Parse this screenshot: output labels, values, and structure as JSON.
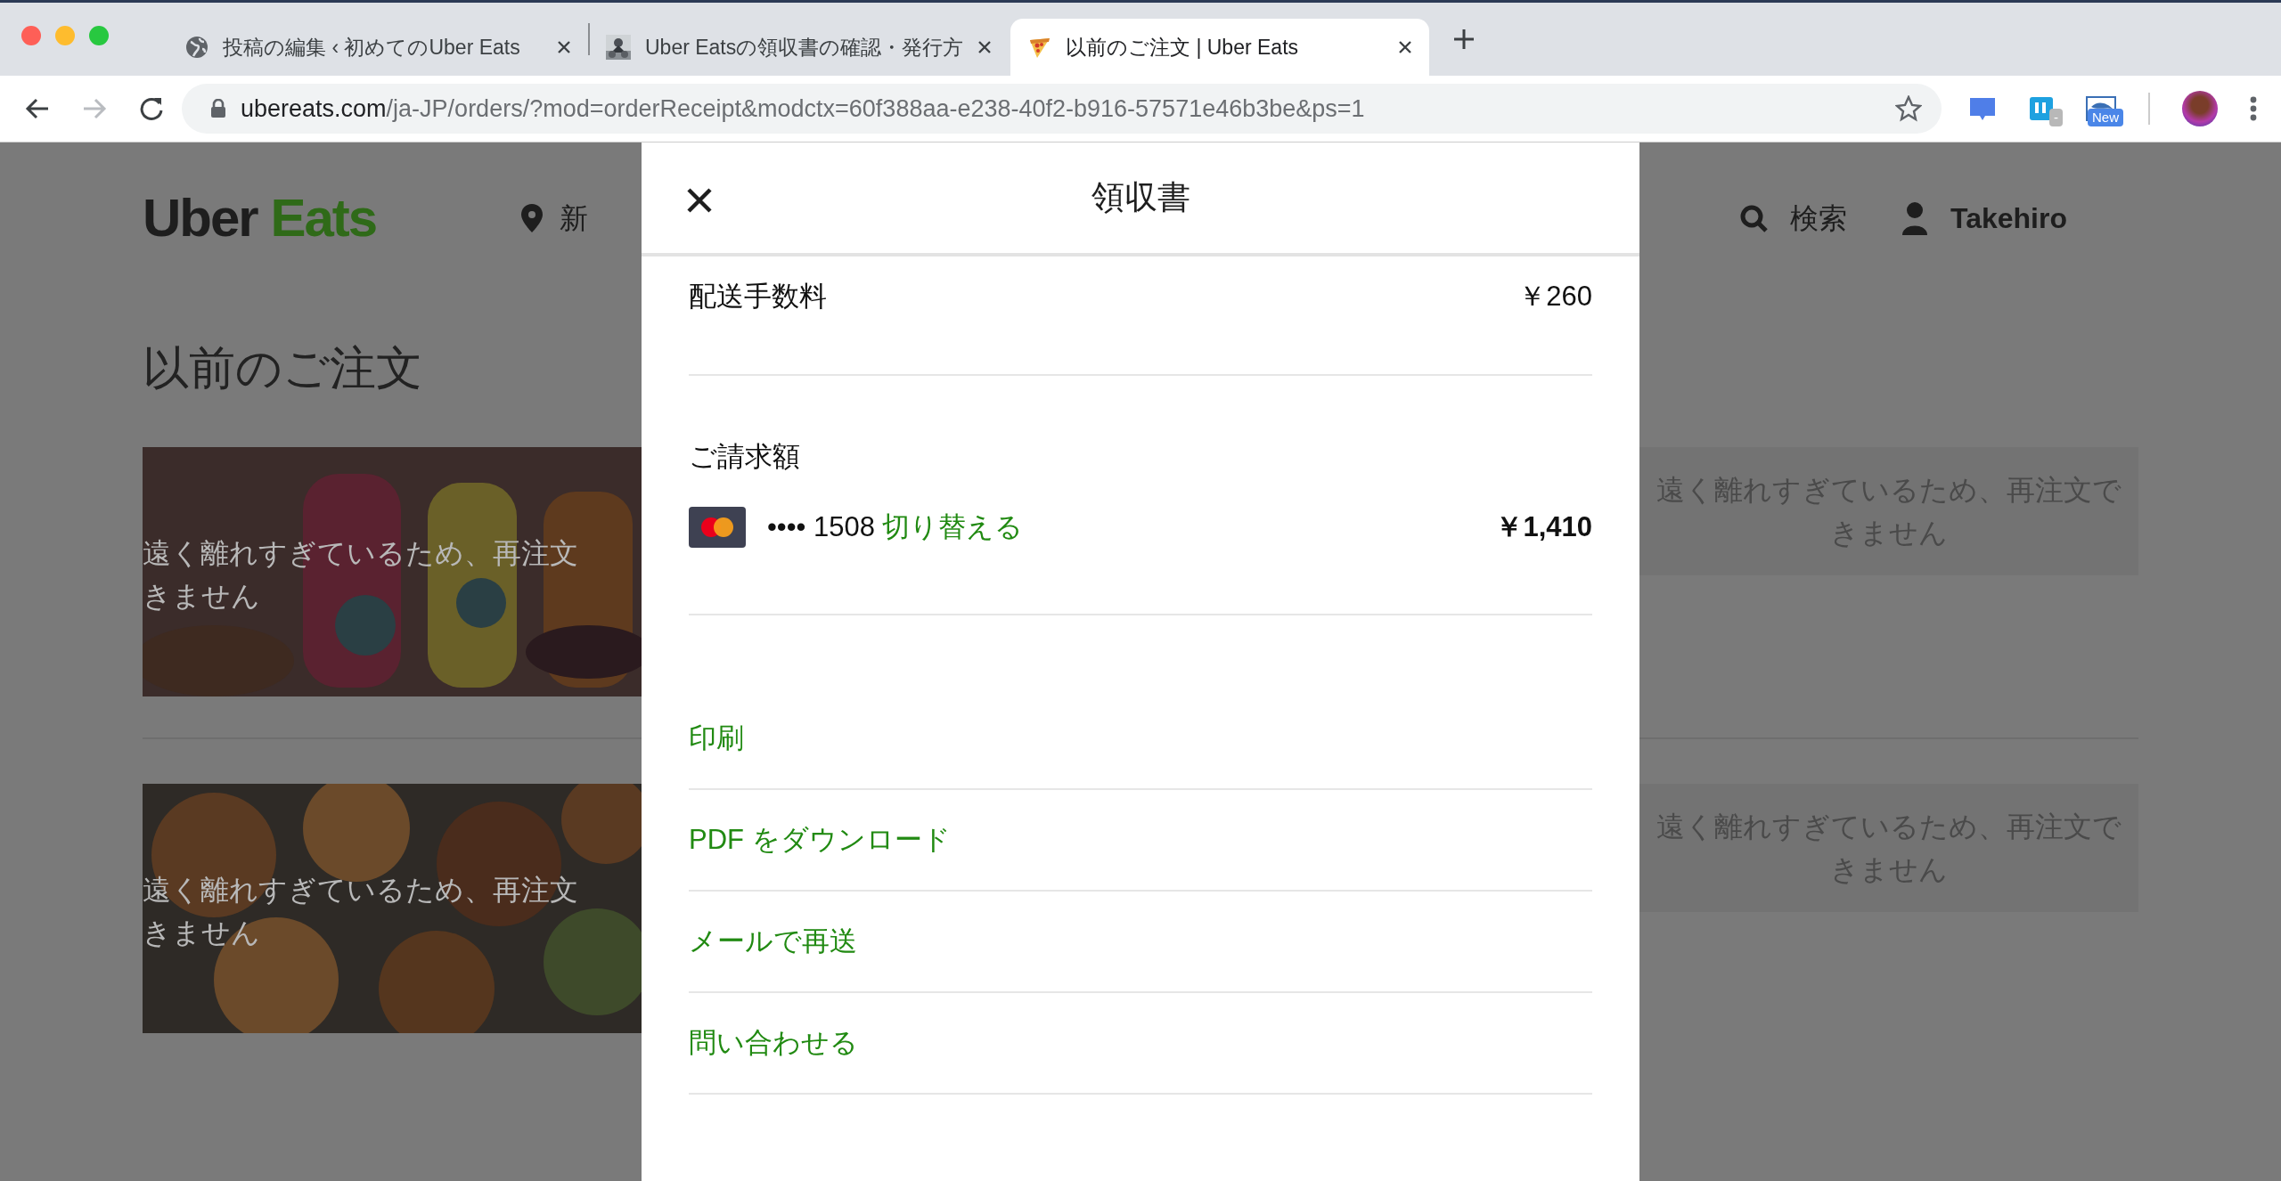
{
  "browser": {
    "tabs": [
      {
        "title": "投稿の編集 ‹ 初めてのUber Eats",
        "selected": false
      },
      {
        "title": "Uber Eatsの領収書の確認・発行方",
        "selected": false
      },
      {
        "title": "以前のご注文 | Uber Eats",
        "selected": true
      }
    ],
    "nav": {
      "back_disabled": false,
      "forward_disabled": true
    },
    "address": {
      "host": "ubereats.com",
      "path": "/ja-JP/orders/?mod=orderReceipt&modctx=60f388aa-e238-40f2-b916-57571e46b3be&ps=1"
    },
    "extensions": [
      {
        "kind": "chat"
      },
      {
        "kind": "bl",
        "badge": "-"
      },
      {
        "kind": "s",
        "badge": "New"
      }
    ]
  },
  "page": {
    "logo": {
      "first": "Uber",
      "second": "Eats"
    },
    "location": "新",
    "search": "検索",
    "user": "Takehiro",
    "heading": "以前のご注文",
    "orders": [
      {
        "overlay_lines": [
          "遠く離れすぎているため、再注文",
          "きません"
        ],
        "notice": "遠く離れすぎているため、再注文できません"
      },
      {
        "overlay_lines": [
          "遠く離れすぎているため、再注文",
          "きません"
        ],
        "notice": "遠く離れすぎているため、再注文できません"
      }
    ]
  },
  "receipt": {
    "title": "領収書",
    "fee": {
      "label": "配送手数料",
      "amount": "￥260"
    },
    "total": {
      "label": "ご請求額",
      "card_digits": "•••• 1508",
      "switch_link": "切り替える",
      "amount": "￥1,410"
    },
    "actions": [
      "印刷",
      "PDF をダウンロード",
      "メールで再送",
      "問い合わせる"
    ]
  }
}
